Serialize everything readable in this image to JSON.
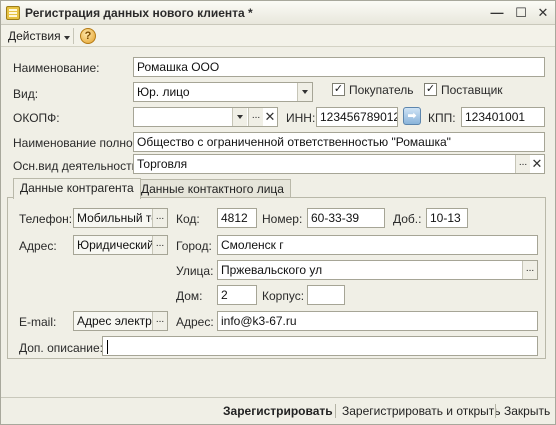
{
  "window": {
    "title": "Регистрация данных нового клиента *",
    "minimize_glyph": "—",
    "maximize_glyph": "☐",
    "close_glyph": "✕"
  },
  "toolbar": {
    "actions_label": "Действия",
    "help_glyph": "?"
  },
  "form": {
    "name_label": "Наименование:",
    "name_value": "Ромашка ООО",
    "kind_label": "Вид:",
    "kind_value": "Юр. лицо",
    "buyer_label": "Покупатель",
    "buyer_checked": true,
    "supplier_label": "Поставщик",
    "supplier_checked": true,
    "okopf_label": "ОКОПФ:",
    "okopf_value": "",
    "inn_label": "ИНН:",
    "inn_value": "123456789012",
    "kpp_label": "КПП:",
    "kpp_value": "123401001",
    "fullname_label": "Наименование полное:",
    "fullname_value": "Общество с ограниченной ответственностью \"Ромашка\"",
    "activity_label": "Осн.вид деятельности:",
    "activity_value": "Торговля"
  },
  "tabs": [
    {
      "label": "Данные контрагента",
      "active": true
    },
    {
      "label": "Данные контактного лица",
      "active": false
    }
  ],
  "contact": {
    "phone_label": "Телефон:",
    "phone_type": "Мобильный те",
    "code_label": "Код:",
    "code_value": "4812",
    "number_label": "Номер:",
    "number_value": "60-33-39",
    "ext_label": "Доб.:",
    "ext_value": "10-13",
    "address_label": "Адрес:",
    "address_type": "Юридический а",
    "city_label": "Город:",
    "city_value": "Смоленск г",
    "street_label": "Улица:",
    "street_value": "Пржевальского ул",
    "house_label": "Дом:",
    "house_value": "2",
    "building_label": "Корпус:",
    "building_value": "",
    "email_label": "E-mail:",
    "email_type": "Адрес электро",
    "email_addr_label": "Адрес:",
    "email_value": "info@k3-67.ru",
    "note_label": "Доп. описание:",
    "note_value": ""
  },
  "buttons": {
    "register": "Зарегистрировать",
    "register_open": "Зарегистрировать и открыть",
    "close": "Закрыть"
  },
  "glyphs": {
    "ellipsis": "...",
    "clear": "✕",
    "check": "✓",
    "arrow_right": "➡"
  }
}
